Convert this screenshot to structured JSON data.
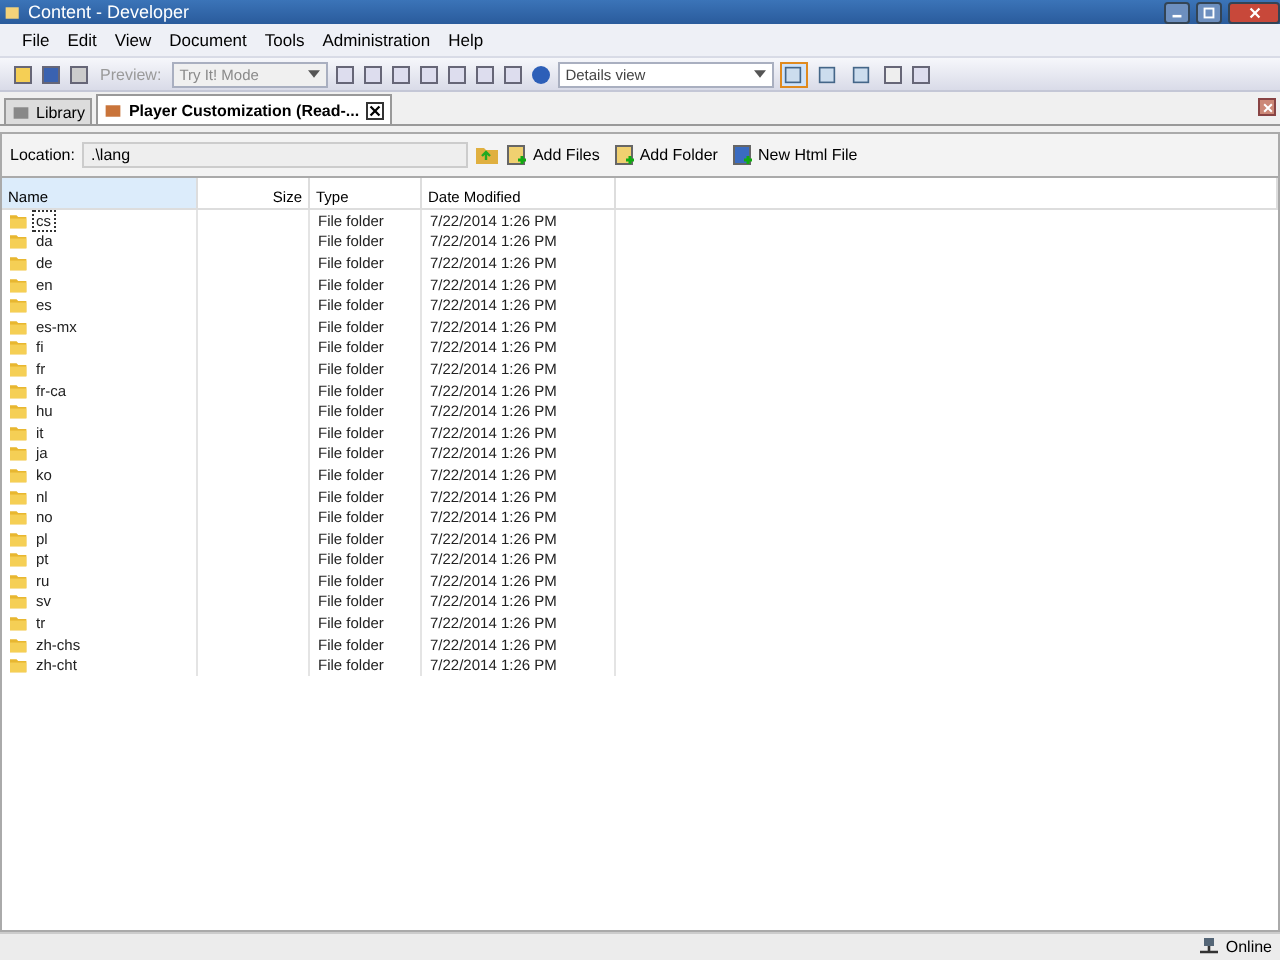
{
  "window": {
    "title": "Content - Developer"
  },
  "menu": [
    "File",
    "Edit",
    "View",
    "Document",
    "Tools",
    "Administration",
    "Help"
  ],
  "toolbar": {
    "preview": {
      "label": "Preview:",
      "disabled": true
    },
    "mode_select": {
      "value": "Try It! Mode"
    },
    "view_select": {
      "value": "Details view"
    },
    "view_buttons": [
      {
        "selected": true
      },
      {
        "selected": false
      },
      {
        "selected": false
      }
    ]
  },
  "tabs": [
    {
      "label": "Library",
      "selected": false,
      "closable": false
    },
    {
      "label": "Player Customization (Read-...",
      "selected": true,
      "closable": true
    }
  ],
  "location": {
    "label": "Location:",
    "value": ".\\lang"
  },
  "actions": [
    "Add Files",
    "Add Folder",
    "New Html File"
  ],
  "table": {
    "columns": [
      "Name",
      "Size",
      "Type",
      "Date Modified"
    ],
    "rows": [
      {
        "name": "cs",
        "type": "File folder",
        "date": "7/22/2014 1:26 PM",
        "selected": true
      },
      {
        "name": "da",
        "type": "File folder",
        "date": "7/22/2014 1:26 PM",
        "selected": false
      },
      {
        "name": "de",
        "type": "File folder",
        "date": "7/22/2014 1:26 PM",
        "selected": false
      },
      {
        "name": "en",
        "type": "File folder",
        "date": "7/22/2014 1:26 PM",
        "selected": false
      },
      {
        "name": "es",
        "type": "File folder",
        "date": "7/22/2014 1:26 PM",
        "selected": false
      },
      {
        "name": "es-mx",
        "type": "File folder",
        "date": "7/22/2014 1:26 PM",
        "selected": false
      },
      {
        "name": "fi",
        "type": "File folder",
        "date": "7/22/2014 1:26 PM",
        "selected": false
      },
      {
        "name": "fr",
        "type": "File folder",
        "date": "7/22/2014 1:26 PM",
        "selected": false
      },
      {
        "name": "fr-ca",
        "type": "File folder",
        "date": "7/22/2014 1:26 PM",
        "selected": false
      },
      {
        "name": "hu",
        "type": "File folder",
        "date": "7/22/2014 1:26 PM",
        "selected": false
      },
      {
        "name": "it",
        "type": "File folder",
        "date": "7/22/2014 1:26 PM",
        "selected": false
      },
      {
        "name": "ja",
        "type": "File folder",
        "date": "7/22/2014 1:26 PM",
        "selected": false
      },
      {
        "name": "ko",
        "type": "File folder",
        "date": "7/22/2014 1:26 PM",
        "selected": false
      },
      {
        "name": "nl",
        "type": "File folder",
        "date": "7/22/2014 1:26 PM",
        "selected": false
      },
      {
        "name": "no",
        "type": "File folder",
        "date": "7/22/2014 1:26 PM",
        "selected": false
      },
      {
        "name": "pl",
        "type": "File folder",
        "date": "7/22/2014 1:26 PM",
        "selected": false
      },
      {
        "name": "pt",
        "type": "File folder",
        "date": "7/22/2014 1:26 PM",
        "selected": false
      },
      {
        "name": "ru",
        "type": "File folder",
        "date": "7/22/2014 1:26 PM",
        "selected": false
      },
      {
        "name": "sv",
        "type": "File folder",
        "date": "7/22/2014 1:26 PM",
        "selected": false
      },
      {
        "name": "tr",
        "type": "File folder",
        "date": "7/22/2014 1:26 PM",
        "selected": false
      },
      {
        "name": "zh-chs",
        "type": "File folder",
        "date": "7/22/2014 1:26 PM",
        "selected": false
      },
      {
        "name": "zh-cht",
        "type": "File folder",
        "date": "7/22/2014 1:26 PM",
        "selected": false
      }
    ]
  },
  "status_bar": {
    "status": "Online"
  }
}
